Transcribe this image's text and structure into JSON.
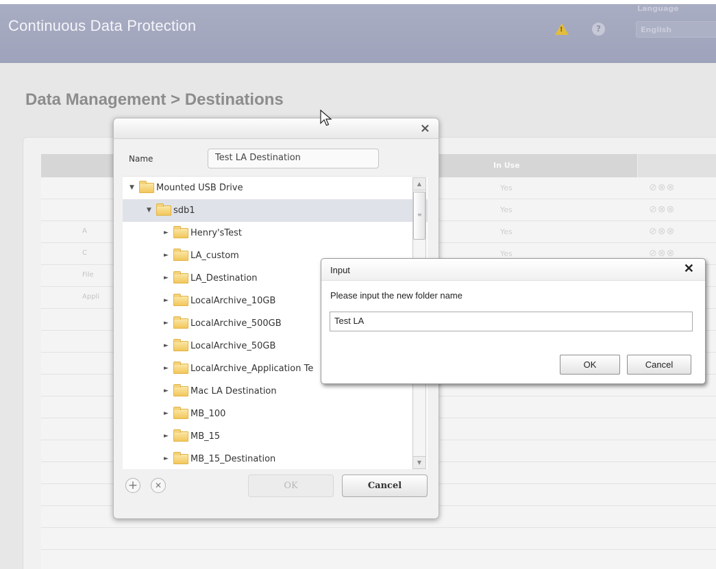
{
  "header": {
    "app_title": "Continuous Data Protection",
    "language_label": "Language",
    "language_value": "English"
  },
  "page": {
    "title": "Data Management > Destinations",
    "table": {
      "header_in_use": "In Use",
      "rows": [
        {
          "label": "",
          "in_use": "Yes"
        },
        {
          "label": "",
          "in_use": "Yes"
        },
        {
          "label": "A",
          "in_use": "Yes"
        },
        {
          "label": "C",
          "in_use": "Yes"
        },
        {
          "label": "File",
          "in_use": ""
        },
        {
          "label": "Appli",
          "in_use": ""
        },
        {
          "label": "",
          "in_use": ""
        },
        {
          "label": "",
          "in_use": ""
        },
        {
          "label": "",
          "in_use": ""
        },
        {
          "label": "",
          "in_use": ""
        },
        {
          "label": "",
          "in_use": ""
        },
        {
          "label": "",
          "in_use": ""
        },
        {
          "label": "",
          "in_use": ""
        },
        {
          "label": "",
          "in_use": ""
        },
        {
          "label": "",
          "in_use": ""
        },
        {
          "label": "",
          "in_use": ""
        },
        {
          "label": "",
          "in_use": ""
        },
        {
          "label": "",
          "in_use": ""
        }
      ]
    }
  },
  "dest_dialog": {
    "close_label": "×",
    "name_label": "Name",
    "name_value": "Test LA Destination",
    "tree": [
      {
        "label": "Mounted USB Drive",
        "level": 0,
        "expanded": true
      },
      {
        "label": "sdb1",
        "level": 1,
        "expanded": true,
        "selected": true
      },
      {
        "label": "Henry'sTest",
        "level": 2
      },
      {
        "label": "LA_custom",
        "level": 2
      },
      {
        "label": "LA_Destination",
        "level": 2
      },
      {
        "label": "LocalArchive_10GB",
        "level": 2
      },
      {
        "label": "LocalArchive_500GB",
        "level": 2
      },
      {
        "label": "LocalArchive_50GB",
        "level": 2
      },
      {
        "label": "LocalArchive_Application Te",
        "level": 2
      },
      {
        "label": "Mac LA Destination",
        "level": 2
      },
      {
        "label": "MB_100",
        "level": 2
      },
      {
        "label": "MB_15",
        "level": 2
      },
      {
        "label": "MB_15_Destination",
        "level": 2
      }
    ],
    "ok_label": "OK",
    "cancel_label": "Cancel"
  },
  "input_dialog": {
    "title": "Input",
    "close_label": "✕",
    "prompt": "Please input the new folder name",
    "value": "Test LA",
    "ok_label": "OK",
    "cancel_label": "Cancel"
  },
  "icons": {
    "warning": "warning-icon",
    "help": "help-icon",
    "add": "add-folder-icon",
    "remove": "remove-folder-icon",
    "folder": "folder-icon"
  },
  "colors": {
    "header_bg": "#a3a8bf",
    "folder": "#f2c75c",
    "warning": "#e2bd3e"
  }
}
